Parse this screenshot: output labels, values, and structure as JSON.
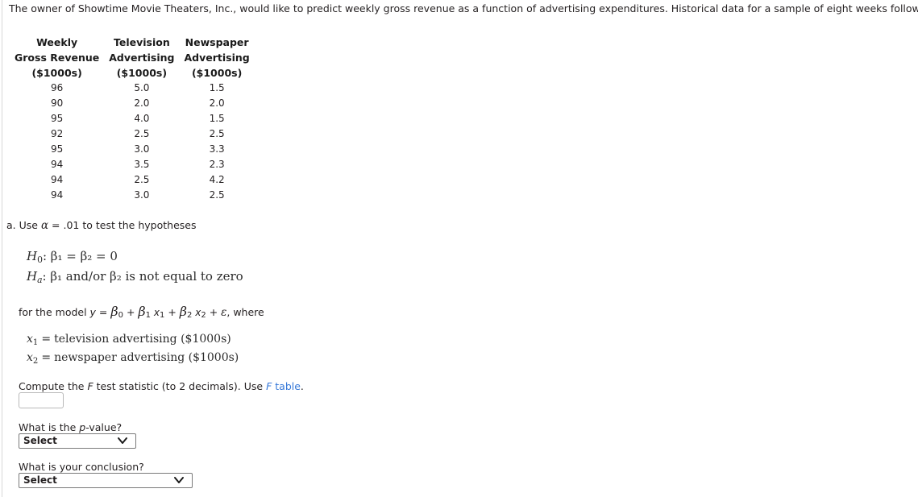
{
  "document": {
    "intro": "The owner of Showtime Movie Theaters, Inc., would like to predict weekly gross revenue as a function of advertising expenditures. Historical data for a sample of eight weeks follow."
  },
  "table": {
    "headers": [
      {
        "line1": "Weekly",
        "line2": "Gross Revenue",
        "line3": "($1000s)"
      },
      {
        "line1": "Television",
        "line2": "Advertising",
        "line3": "($1000s)"
      },
      {
        "line1": "Newspaper",
        "line2": "Advertising",
        "line3": "($1000s)"
      }
    ],
    "rows": [
      {
        "revenue": "96",
        "tv": "5.0",
        "newspaper": "1.5"
      },
      {
        "revenue": "90",
        "tv": "2.0",
        "newspaper": "2.0"
      },
      {
        "revenue": "95",
        "tv": "4.0",
        "newspaper": "1.5"
      },
      {
        "revenue": "92",
        "tv": "2.5",
        "newspaper": "2.5"
      },
      {
        "revenue": "95",
        "tv": "3.0",
        "newspaper": "3.3"
      },
      {
        "revenue": "94",
        "tv": "3.5",
        "newspaper": "2.3"
      },
      {
        "revenue": "94",
        "tv": "2.5",
        "newspaper": "4.2"
      },
      {
        "revenue": "94",
        "tv": "3.0",
        "newspaper": "2.5"
      }
    ]
  },
  "part_a": {
    "label": "a.",
    "prompt_before_alpha": "Use ",
    "alpha_symbol": "α",
    "prompt_after_alpha": " = .01 to test the hypotheses",
    "hypotheses": {
      "null_label": "H",
      "null_sub": "0",
      "null_body": ": β₁ = β₂ = 0",
      "alt_label": "H",
      "alt_sub": "a",
      "alt_body": ": β₁ and/or β₂ is not equal to zero"
    },
    "model": {
      "prefix": "for the model ",
      "y": "y",
      "equals": " = ",
      "beta": "β",
      "b0_sub": "0",
      "plus": " + ",
      "b1_sub": "1",
      "x": "x",
      "x1_sub": "1",
      "b2_sub": "2",
      "x2_sub": "2",
      "epsilon": "ε",
      "suffix": ", where"
    },
    "variable_definitions": [
      {
        "symbol": "x",
        "subscript": "1",
        "equals": "=",
        "text": "television advertising ($1000s)"
      },
      {
        "symbol": "x",
        "subscript": "2",
        "equals": "=",
        "text": "newspaper advertising ($1000s)"
      }
    ],
    "compute": {
      "text_before": "Compute the ",
      "f_symbol": "F",
      "text_middle": " test statistic (to 2 decimals). Use ",
      "link_f": "F",
      "link_text": " table",
      "text_after": "."
    },
    "f_input": {
      "value": "",
      "placeholder": ""
    },
    "pvalue_question": {
      "text_before": "What is the ",
      "p_symbol": "p",
      "text_after": "-value?"
    },
    "pvalue_select": {
      "selected": "Select",
      "options": [
        "Select"
      ]
    },
    "conclusion_question": "What is your conclusion?",
    "conclusion_select": {
      "selected": "Select",
      "options": [
        "Select"
      ]
    }
  },
  "colors": {
    "link": "#3678d8",
    "text": "#231f20",
    "border": "#7a7a7a"
  }
}
